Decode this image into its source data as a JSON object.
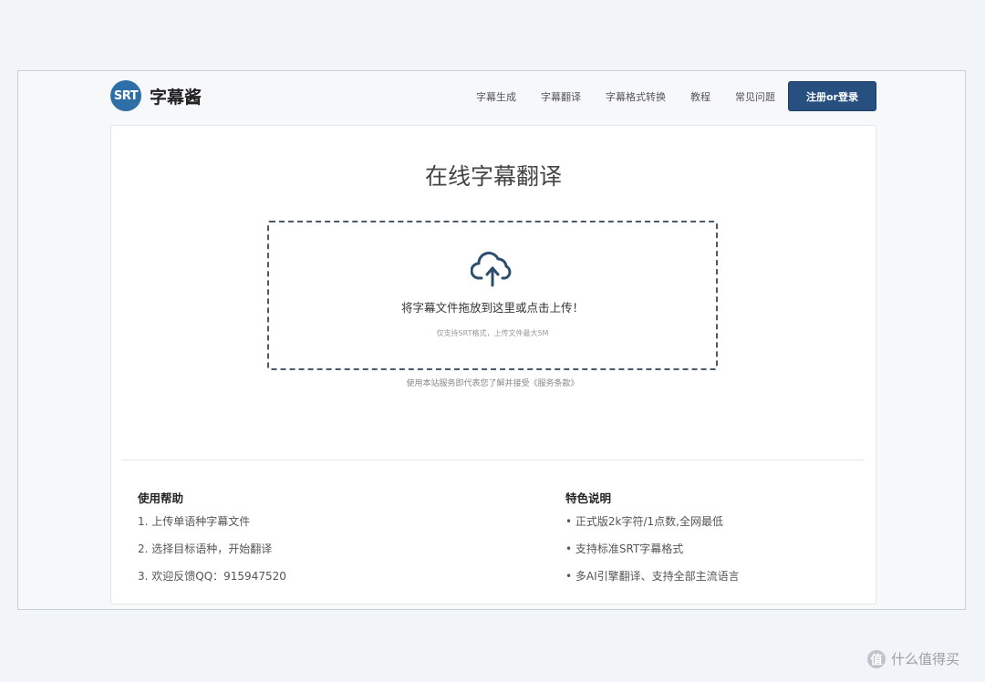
{
  "header": {
    "logo_badge": "SRT",
    "logo_text": "字幕酱",
    "nav": [
      "字幕生成",
      "字幕翻译",
      "字幕格式转换",
      "教程",
      "常见问题"
    ],
    "login_label": "注册or登录"
  },
  "main": {
    "title": "在线字幕翻译",
    "upload": {
      "icon": "cloud-upload-icon",
      "main_text": "将字幕文件拖放到这里或点击上传！",
      "hint_text": "仅支持SRT格式，上传文件最大5M"
    },
    "terms_text": "使用本站服务即代表您了解并接受《服务条款》"
  },
  "help": {
    "title": "使用帮助",
    "items": [
      "1. 上传单语种字幕文件",
      "2. 选择目标语种，开始翻译",
      "3. 欢迎反馈QQ：915947520"
    ]
  },
  "features": {
    "title": "特色说明",
    "items": [
      "• 正式版2k字符/1点数,全网最低",
      "• 支持标准SRT字幕格式",
      "• 多AI引擎翻译、支持全部主流语言"
    ]
  },
  "watermark": {
    "badge": "值",
    "text": "什么值得买"
  },
  "colors": {
    "accent": "#274f7f",
    "logo": "#2f6fa8"
  }
}
